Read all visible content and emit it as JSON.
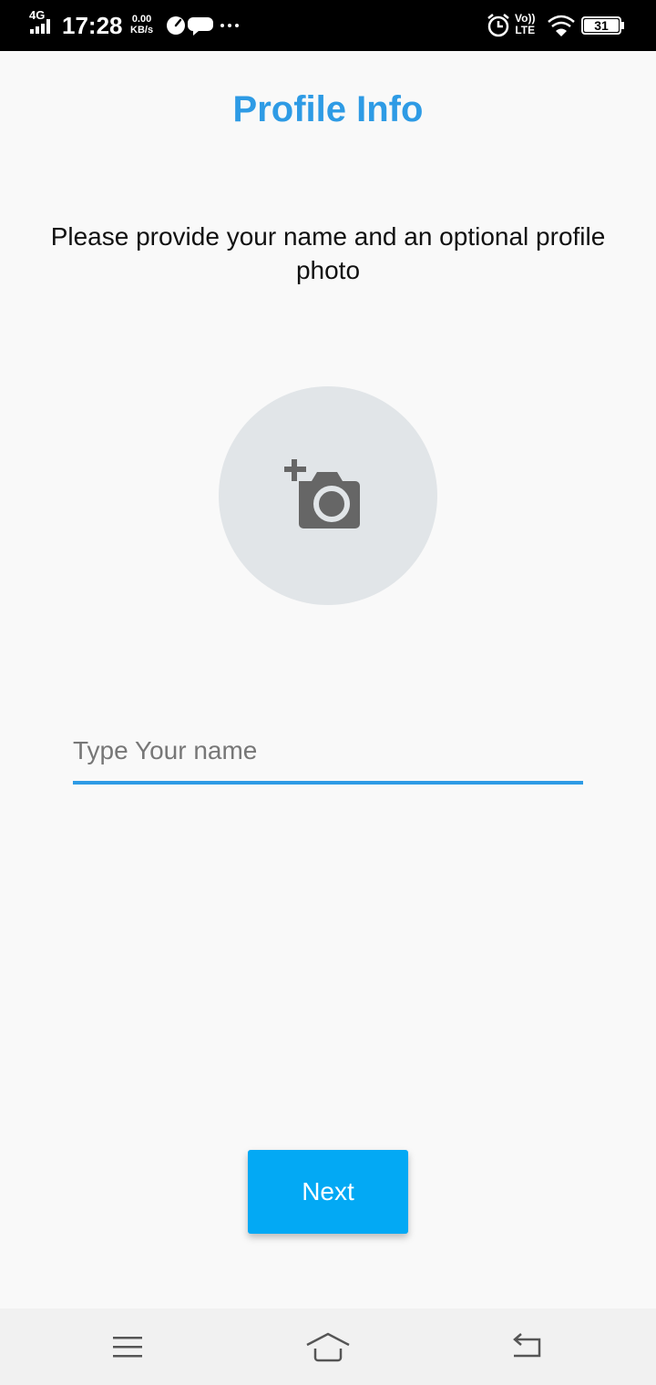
{
  "status_bar": {
    "network": "4G",
    "time": "17:28",
    "speed_value": "0.00",
    "speed_unit": "KB/s",
    "volte": "Vo))",
    "lte": "LTE",
    "battery": "31"
  },
  "page": {
    "title": "Profile Info",
    "instructions": "Please provide your name and an optional profile photo"
  },
  "name_field": {
    "placeholder": "Type Your name",
    "value": ""
  },
  "next_button": {
    "label": "Next"
  },
  "colors": {
    "accent": "#2e9be5",
    "button": "#03a9f4",
    "avatar_bg": "#e1e5e8",
    "icon_gray": "#666666"
  },
  "icons": {
    "add_photo": "add-a-photo-icon",
    "nav_menu": "menu-icon",
    "nav_home": "home-icon",
    "nav_back": "back-icon"
  }
}
